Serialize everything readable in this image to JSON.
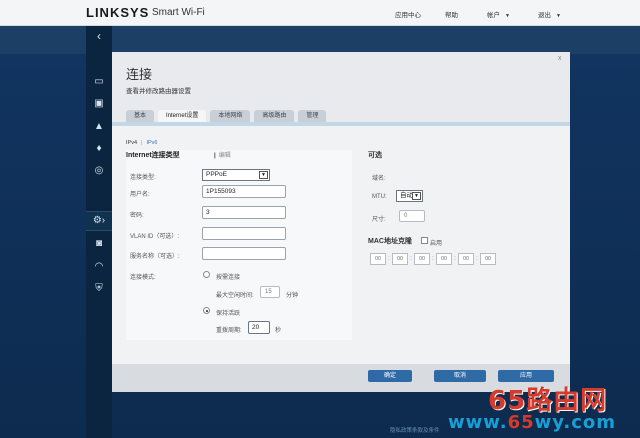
{
  "header": {
    "brand": "LINKSYS",
    "product": "Smart Wi-Fi",
    "nav": [
      "应用中心",
      "帮助",
      "帐户",
      "退出"
    ]
  },
  "dialog": {
    "title": "连接",
    "subtitle": "查看并修改路由器设置",
    "close": "x",
    "tabs": [
      "基本",
      "Internet设置",
      "本地网络",
      "高级路由",
      "管理"
    ],
    "active_tab": "Internet设置",
    "ipv": {
      "v4": "IPv4",
      "sep": "|",
      "v6": "IPv6"
    },
    "left": {
      "title": "Internet连接类型",
      "edit": "编辑",
      "conn_type_label": "连接类型:",
      "conn_type_value": "PPPoE",
      "username_label": "用户名:",
      "username_value": "1P155093",
      "password_label": "密码:",
      "password_value": "3",
      "vlan_label": "VLAN ID（可选）:",
      "vlan_value": "",
      "service_label": "服务名称（可选）:",
      "service_value": "",
      "mode_label": "连接模式:",
      "on_demand": "按需连接",
      "max_idle_label": "最大空闲时间:",
      "max_idle_value": "15",
      "minutes": "分钟",
      "keep_alive": "保持活跃",
      "redial_label": "重拨周期:",
      "redial_value": "20",
      "seconds": "秒"
    },
    "right": {
      "title": "可选",
      "hostname_label": "域名:",
      "mtu_label": "MTU:",
      "mtu_value": "自动",
      "size_label": "尺寸:",
      "size_value": "0",
      "mac_title": "MAC地址克隆",
      "mac_enable": "启用",
      "mac_octets": [
        "00",
        "00",
        "00",
        "00",
        "00",
        "00"
      ]
    },
    "buttons": {
      "ok": "确定",
      "cancel": "取消",
      "apply": "应用"
    }
  },
  "watermark": {
    "cn": "65路由网",
    "url_pre": "www.",
    "url_mid": "65",
    "url_post": "wy.com"
  },
  "bottom_link": "隐私政策条款及条件"
}
